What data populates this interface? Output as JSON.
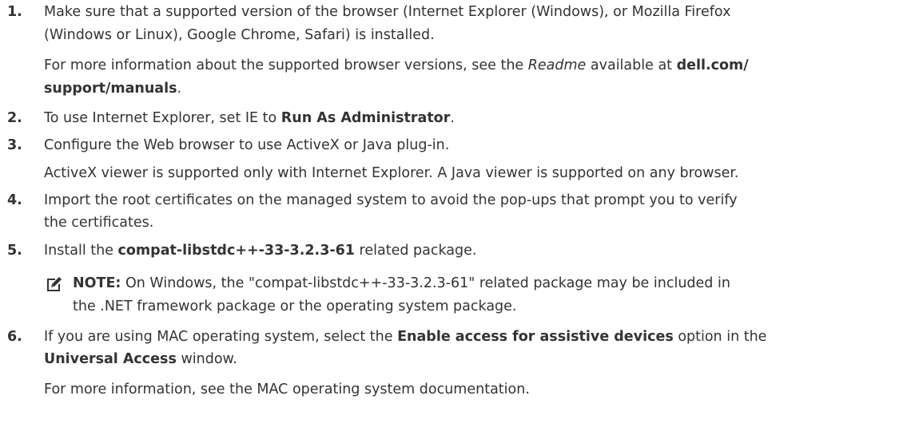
{
  "steps": [
    {
      "number": "1.",
      "line1": "Make sure that a supported version of the browser (Internet Explorer (Windows), or Mozilla Firefox",
      "line2": "(Windows or Linux), Google Chrome, Safari) is installed.",
      "info_prefix": "For more information about the supported browser versions, see the ",
      "info_italic": "Readme",
      "info_mid": " available at ",
      "info_bold_1": "dell.com/",
      "info_bold_2": "support/manuals",
      "info_end": "."
    },
    {
      "number": "2.",
      "prefix": "To use Internet Explorer, set IE to ",
      "bold": "Run As Administrator",
      "suffix": "."
    },
    {
      "number": "3.",
      "line1": "Configure the Web browser to use ActiveX or Java plug-in.",
      "info": "ActiveX viewer is supported only with Internet Explorer. A Java viewer is supported on any browser."
    },
    {
      "number": "4.",
      "line1": "Import the root certificates on the managed system to avoid the pop-ups that prompt you to verify",
      "line2": "the certificates."
    },
    {
      "number": "5.",
      "prefix": "Install the ",
      "bold": "compat-libstdc++-33-3.2.3-61",
      "suffix": " related package.",
      "note_label": "NOTE:",
      "note_line1": " On Windows, the \"compat-libstdc++-33-3.2.3-61\" related package may be included in",
      "note_line2": "the .NET framework package or the operating system package."
    },
    {
      "number": "6.",
      "prefix": "If you are using MAC operating system, select the ",
      "bold_1": "Enable access for assistive devices",
      "mid": " option in the",
      "bold_2": "Universal Access",
      "suffix": " window.",
      "info": "For more information, see the MAC operating system documentation."
    }
  ],
  "note_icon": "pencil-note-icon"
}
